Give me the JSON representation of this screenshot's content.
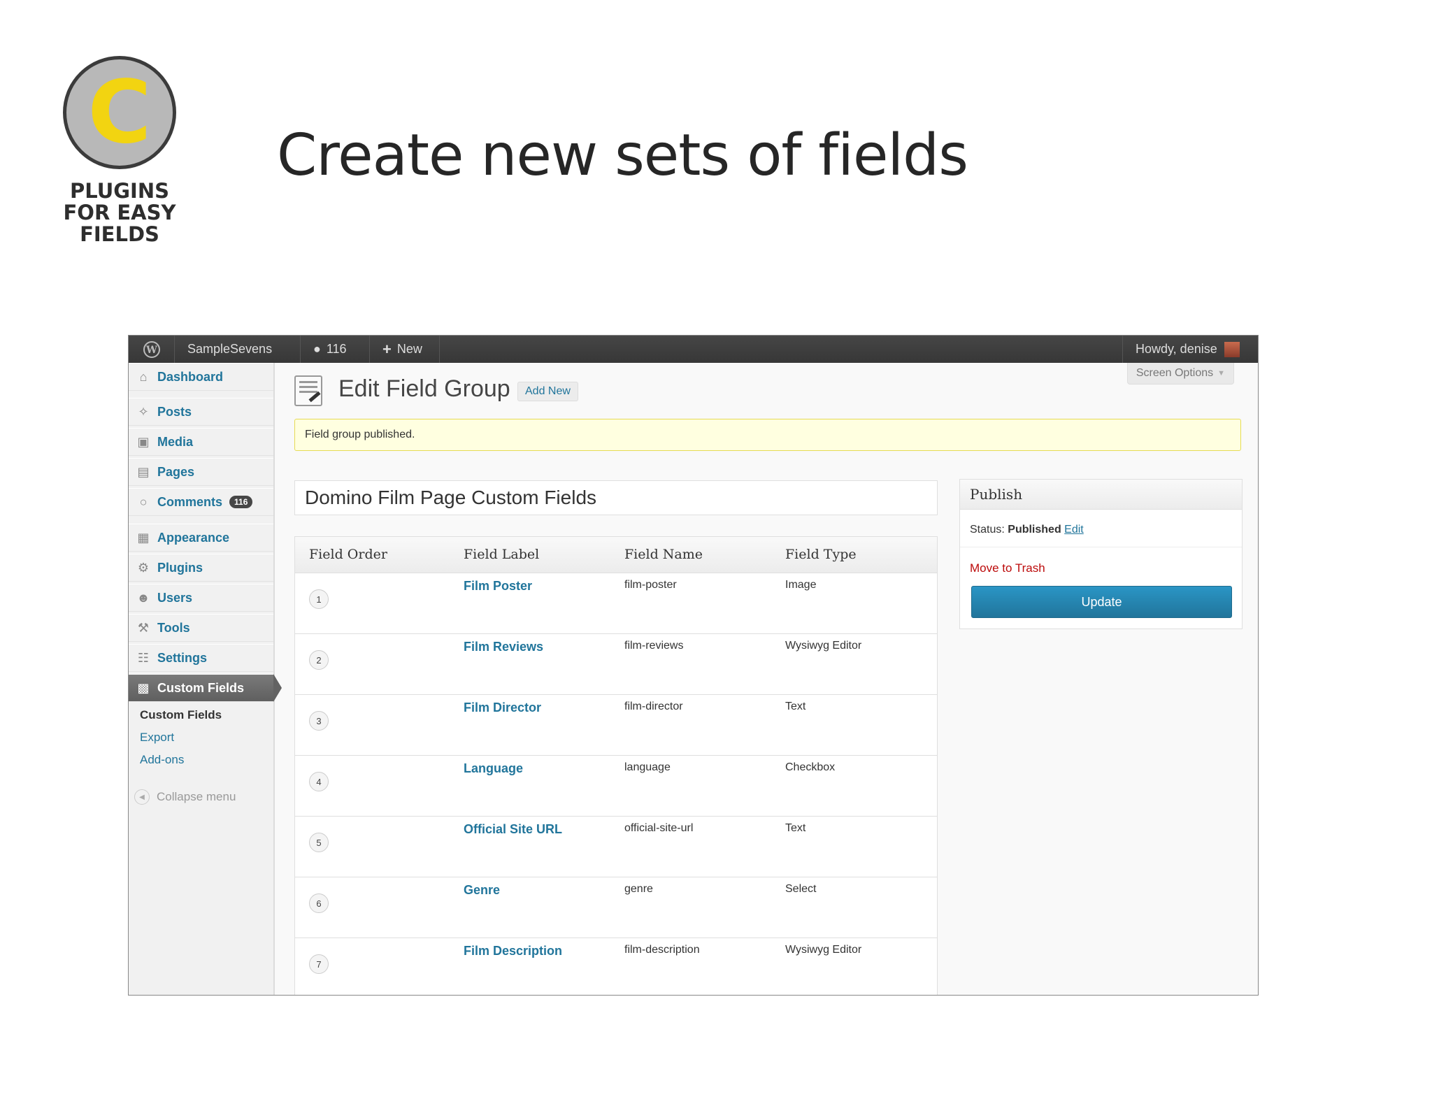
{
  "slide": {
    "badge_letter": "C",
    "badge_caption_lines": [
      "PLUGINS",
      "FOR EASY",
      "FIELDS"
    ],
    "title": "Create new sets of fields"
  },
  "adminbar": {
    "site_name": "SampleSevens",
    "comments_count": "116",
    "new_label": "New",
    "howdy": "Howdy, denise"
  },
  "screen_options": "Screen Options",
  "menu": {
    "dashboard": "Dashboard",
    "posts": "Posts",
    "media": "Media",
    "pages": "Pages",
    "comments": "Comments",
    "comments_badge": "116",
    "appearance": "Appearance",
    "plugins": "Plugins",
    "users": "Users",
    "tools": "Tools",
    "settings": "Settings",
    "custom_fields": "Custom Fields",
    "sub": [
      "Custom Fields",
      "Export",
      "Add-ons"
    ],
    "collapse": "Collapse menu"
  },
  "page": {
    "heading": "Edit Field Group",
    "add_new": "Add New",
    "notice": "Field group published.",
    "group_title": "Domino Film Page Custom Fields"
  },
  "table": {
    "headers": [
      "Field Order",
      "Field Label",
      "Field Name",
      "Field Type"
    ],
    "rows": [
      {
        "order": "1",
        "label": "Film Poster",
        "name": "film-poster",
        "type": "Image"
      },
      {
        "order": "2",
        "label": "Film Reviews",
        "name": "film-reviews",
        "type": "Wysiwyg Editor"
      },
      {
        "order": "3",
        "label": "Film Director",
        "name": "film-director",
        "type": "Text"
      },
      {
        "order": "4",
        "label": "Language",
        "name": "language",
        "type": "Checkbox"
      },
      {
        "order": "5",
        "label": "Official Site URL",
        "name": "official-site-url",
        "type": "Text"
      },
      {
        "order": "6",
        "label": "Genre",
        "name": "genre",
        "type": "Select"
      },
      {
        "order": "7",
        "label": "Film Description",
        "name": "film-description",
        "type": "Wysiwyg Editor"
      }
    ]
  },
  "publish": {
    "title": "Publish",
    "status_label": "Status:",
    "status_value": "Published",
    "edit": "Edit",
    "trash": "Move to Trash",
    "update": "Update"
  },
  "colors": {
    "link": "#21759b",
    "badge_yellow": "#f2d411",
    "trash_red": "#bc0b0b",
    "notice_bg": "#ffffe0"
  }
}
